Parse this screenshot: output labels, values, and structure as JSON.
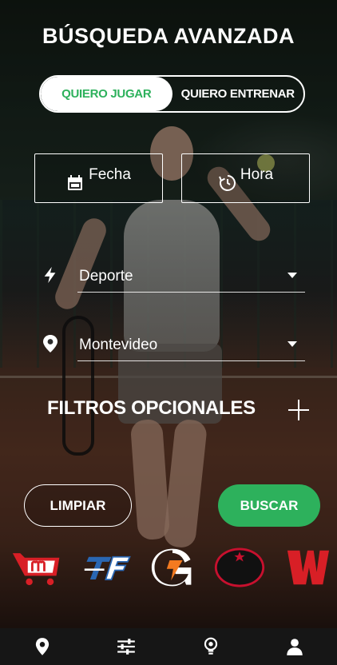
{
  "page": {
    "title": "BÚSQUEDA AVANZADA"
  },
  "mode_toggle": {
    "options": [
      {
        "label": "QUIERO JUGAR",
        "active": true
      },
      {
        "label": "QUIERO ENTRENAR",
        "active": false
      }
    ]
  },
  "date_time": {
    "date_label": "Fecha",
    "date_icon": "calendar-icon",
    "time_label": "Hora",
    "time_icon": "clock-history-icon"
  },
  "selects": {
    "sport": {
      "value": "Deporte",
      "icon": "lightning-icon"
    },
    "city": {
      "value": "Montevideo",
      "icon": "location-pin-icon"
    }
  },
  "optional_filters": {
    "label": "FILTROS OPCIONALES",
    "icon": "plus-icon"
  },
  "actions": {
    "clear_label": "LIMPIAR",
    "search_label": "BUSCAR"
  },
  "sponsors": [
    {
      "name": "m",
      "icon": "cart-logo"
    },
    {
      "name": "TF",
      "icon": "tf-logo"
    },
    {
      "name": "G",
      "icon": "gatorade-logo"
    },
    {
      "name": "Estrella Galicia",
      "icon": "estrella-galicia-logo"
    },
    {
      "name": "W",
      "icon": "wilson-logo"
    }
  ],
  "tabbar": {
    "items": [
      {
        "icon": "location-pin-icon"
      },
      {
        "icon": "sliders-icon"
      },
      {
        "icon": "lightbulb-icon"
      },
      {
        "icon": "user-icon"
      }
    ]
  },
  "colors": {
    "accent": "#2db15c",
    "tabbar_bg": "#161616",
    "logo_red": "#d81f26",
    "logo_blue": "#2a67b3"
  }
}
